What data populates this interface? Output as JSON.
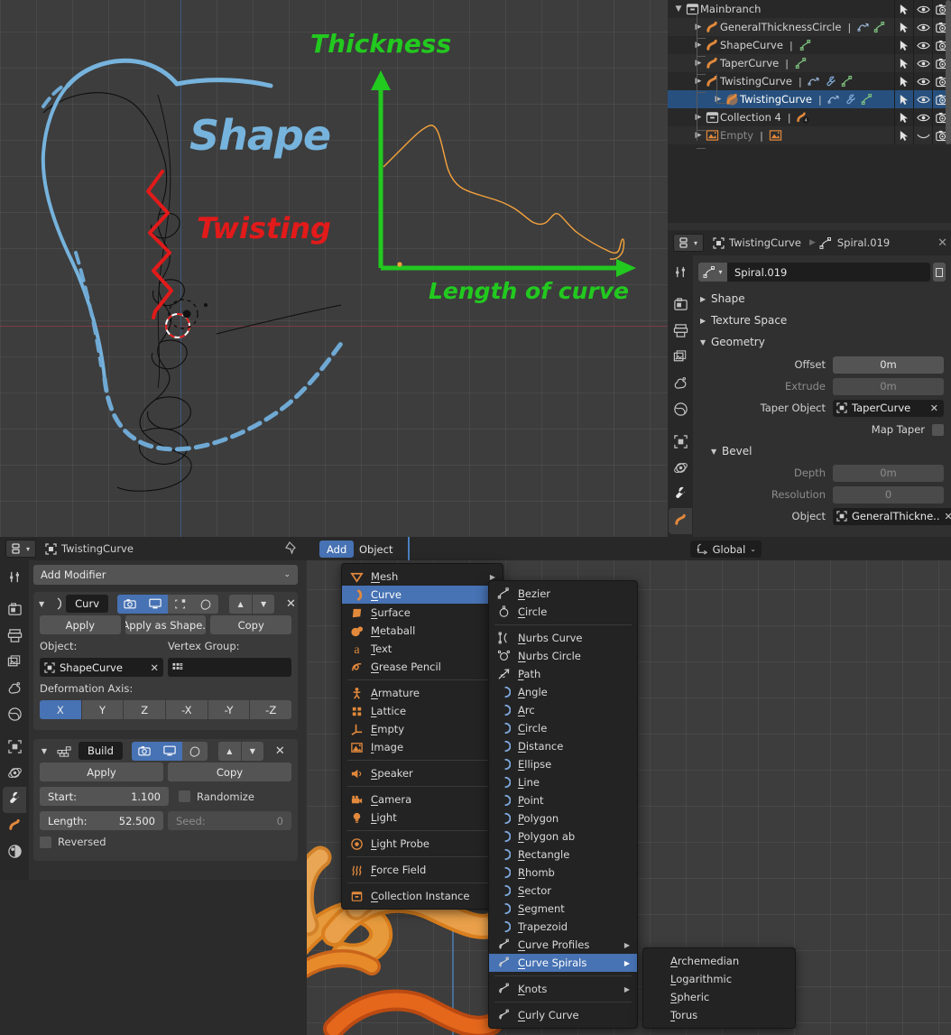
{
  "outliner": {
    "rows": [
      {
        "label": "Mainbranch",
        "icon": "collection-icon",
        "depth": 0,
        "disclosure": "down",
        "selected": false,
        "dimmed": false,
        "badges": []
      },
      {
        "label": "GeneralThicknessCircle",
        "icon": "curve-data-icon",
        "depth": 1,
        "disclosure": "right",
        "selected": false,
        "dimmed": false,
        "badges": [
          "animation-icon",
          "curve-data-icon"
        ]
      },
      {
        "label": "ShapeCurve",
        "icon": "curve-data-icon",
        "depth": 1,
        "disclosure": "right",
        "selected": false,
        "dimmed": false,
        "badges": [
          "curve-data-icon"
        ]
      },
      {
        "label": "TaperCurve",
        "icon": "curve-data-icon",
        "depth": 1,
        "disclosure": "right",
        "selected": false,
        "dimmed": false,
        "badges": [
          "curve-data-icon"
        ]
      },
      {
        "label": "TwistingCurve",
        "icon": "curve-data-icon",
        "depth": 1,
        "disclosure": "right",
        "selected": false,
        "dimmed": false,
        "badges": [
          "animation-icon",
          "wrench-icon",
          "curve-data-icon"
        ]
      },
      {
        "label": "TwistingCurve",
        "icon": "curve-object-icon",
        "depth": 2,
        "disclosure": "right",
        "selected": true,
        "dimmed": false,
        "badges": [
          "animation-icon",
          "wrench-icon",
          "curve-data-icon"
        ]
      },
      {
        "label": "Collection 4",
        "icon": "collection-icon",
        "depth": 1,
        "disclosure": "right",
        "selected": false,
        "dimmed": false,
        "badges": [
          "curve-count-4"
        ]
      },
      {
        "label": "Empty",
        "icon": "image-empty-icon",
        "depth": 1,
        "disclosure": "right",
        "selected": false,
        "dimmed": true,
        "badges": [
          "image-empty-icon"
        ]
      }
    ],
    "row_controls": [
      "cursor-select-icon",
      "eye-visibility-icon",
      "camera-render-icon"
    ]
  },
  "properties": {
    "editor_type": "properties-editor-icon",
    "breadcrumb": [
      {
        "icon": "object-icon",
        "label": "TwistingCurve"
      },
      {
        "icon": "curve-data-icon",
        "label": "Spiral.019"
      }
    ],
    "datablock_name": "Spiral.019",
    "tabs": [
      {
        "name": "tool-icon",
        "active": false
      },
      {
        "name": "render-icon",
        "active": false
      },
      {
        "name": "output-icon",
        "active": false
      },
      {
        "name": "view-layer-icon",
        "active": false
      },
      {
        "name": "scene-icon",
        "active": false
      },
      {
        "name": "world-icon",
        "active": false
      },
      {
        "name": "object-icon",
        "active": false
      },
      {
        "name": "physics-icon",
        "active": false
      },
      {
        "name": "modifier-wrench-icon",
        "active": false
      },
      {
        "name": "curve-data-icon",
        "active": true
      }
    ],
    "panels": [
      {
        "title": "Shape",
        "open": false
      },
      {
        "title": "Texture Space",
        "open": false
      },
      {
        "title": "Geometry",
        "open": true
      }
    ],
    "geometry": {
      "offset_label": "Offset",
      "offset_value": "0m",
      "extrude_label": "Extrude",
      "extrude_value": "0m",
      "taper_label": "Taper Object",
      "taper_value": "TaperCurve",
      "map_taper_label": "Map Taper",
      "map_taper_checked": false
    },
    "bevel": {
      "title": "Bevel",
      "depth_label": "Depth",
      "depth_value": "0m",
      "resolution_label": "Resolution",
      "resolution_value": "0",
      "object_label": "Object",
      "object_value": "GeneralThickne.."
    }
  },
  "modifier_editor": {
    "editor_type": "properties-editor-icon",
    "object_icon": "object-icon",
    "object_name": "TwistingCurve",
    "pin_icon": "pin-icon",
    "add_modifier_label": "Add Modifier",
    "tabs": [
      {
        "name": "tool-icon",
        "active": false
      },
      {
        "name": "render-icon",
        "active": false
      },
      {
        "name": "output-icon",
        "active": false
      },
      {
        "name": "view-layer-icon",
        "active": false
      },
      {
        "name": "scene-icon",
        "active": false
      },
      {
        "name": "world-icon",
        "active": false
      },
      {
        "name": "object-icon",
        "active": false
      },
      {
        "name": "physics-icon",
        "active": false
      },
      {
        "name": "modifier-wrench-icon",
        "active": true
      },
      {
        "name": "curve-data-icon",
        "active": false
      },
      {
        "name": "material-icon",
        "active": false
      }
    ],
    "modifiers": [
      {
        "type": "curve",
        "name": "Curv",
        "icon": "curve-modifier-icon",
        "toggles": [
          {
            "name": "render-toggle",
            "on": true
          },
          {
            "name": "realtime-toggle",
            "on": true
          },
          {
            "name": "edit-mode-toggle",
            "on": false
          },
          {
            "name": "on-cage-toggle",
            "on": false
          }
        ],
        "buttons": [
          "Apply",
          "Apply as Shape..",
          "Copy"
        ],
        "object_label": "Object:",
        "object_value": "ShapeCurve",
        "vertex_group_label": "Vertex Group:",
        "vertex_group_value": "",
        "deformation_axis_label": "Deformation Axis:",
        "axes": [
          "X",
          "Y",
          "Z",
          "-X",
          "-Y",
          "-Z"
        ],
        "axis_selected": "X"
      },
      {
        "type": "build",
        "name": "Build",
        "icon": "build-modifier-icon",
        "toggles": [
          {
            "name": "render-toggle",
            "on": true
          },
          {
            "name": "realtime-toggle",
            "on": true
          },
          {
            "name": "edit-mode-toggle",
            "on": false
          }
        ],
        "buttons": [
          "Apply",
          "Copy"
        ],
        "start_label": "Start:",
        "start_value": "1.100",
        "length_label": "Length:",
        "length_value": "52.500",
        "randomize_label": "Randomize",
        "randomize_checked": false,
        "seed_label": "Seed:",
        "seed_value": "0",
        "reversed_label": "Reversed",
        "reversed_checked": false
      }
    ]
  },
  "bottom_viewport": {
    "header": {
      "menus": [
        {
          "label": "Add",
          "active": true
        },
        {
          "label": "Object",
          "active": false
        }
      ],
      "orientation_label": "Global",
      "orientation_icon": "orientation-gizmo-icon"
    },
    "add_menu": [
      {
        "label": "Mesh",
        "icon": "mesh-icon",
        "submenu": true,
        "sep_after": false,
        "highlight": false
      },
      {
        "label": "Curve",
        "icon": "curve-icon",
        "submenu": true,
        "sep_after": false,
        "highlight": true
      },
      {
        "label": "Surface",
        "icon": "surface-icon",
        "submenu": true,
        "sep_after": false,
        "highlight": false
      },
      {
        "label": "Metaball",
        "icon": "metaball-icon",
        "submenu": true,
        "sep_after": false,
        "highlight": false
      },
      {
        "label": "Text",
        "icon": "text-icon",
        "submenu": false,
        "sep_after": false,
        "highlight": false
      },
      {
        "label": "Grease Pencil",
        "icon": "grease-pencil-icon",
        "submenu": true,
        "sep_after": true,
        "highlight": false
      },
      {
        "label": "Armature",
        "icon": "armature-icon",
        "submenu": true,
        "sep_after": false,
        "highlight": false
      },
      {
        "label": "Lattice",
        "icon": "lattice-icon",
        "submenu": false,
        "sep_after": false,
        "highlight": false
      },
      {
        "label": "Empty",
        "icon": "empty-icon",
        "submenu": true,
        "sep_after": false,
        "highlight": false
      },
      {
        "label": "Image",
        "icon": "image-icon",
        "submenu": true,
        "sep_after": true,
        "highlight": false
      },
      {
        "label": "Speaker",
        "icon": "speaker-icon",
        "submenu": false,
        "sep_after": true,
        "highlight": false
      },
      {
        "label": "Camera",
        "icon": "camera-icon",
        "submenu": false,
        "sep_after": false,
        "highlight": false
      },
      {
        "label": "Light",
        "icon": "light-icon",
        "submenu": true,
        "sep_after": true,
        "highlight": false
      },
      {
        "label": "Light Probe",
        "icon": "light-probe-icon",
        "submenu": true,
        "sep_after": true,
        "highlight": false
      },
      {
        "label": "Force Field",
        "icon": "force-field-icon",
        "submenu": true,
        "sep_after": true,
        "highlight": false
      },
      {
        "label": "Collection Instance",
        "icon": "collection-instance-icon",
        "submenu": true,
        "sep_after": false,
        "highlight": false
      }
    ],
    "curve_menu": [
      {
        "label": "Bezier",
        "icon": "bezier-icon",
        "submenu": false,
        "sep_after": false,
        "highlight": false
      },
      {
        "label": "Circle",
        "icon": "bezier-circle-icon",
        "submenu": false,
        "sep_after": true,
        "highlight": false
      },
      {
        "label": "Nurbs Curve",
        "icon": "nurbs-curve-icon",
        "submenu": false,
        "sep_after": false,
        "highlight": false
      },
      {
        "label": "Nurbs Circle",
        "icon": "nurbs-circle-icon",
        "submenu": false,
        "sep_after": false,
        "highlight": false
      },
      {
        "label": "Path",
        "icon": "path-icon",
        "submenu": false,
        "sep_after": false,
        "highlight": false
      },
      {
        "label": "Angle",
        "icon": "curve-arc-icon",
        "submenu": false,
        "sep_after": false,
        "highlight": false
      },
      {
        "label": "Arc",
        "icon": "curve-arc-icon",
        "submenu": false,
        "sep_after": false,
        "highlight": false
      },
      {
        "label": "Circle",
        "icon": "curve-arc-icon",
        "submenu": false,
        "sep_after": false,
        "highlight": false
      },
      {
        "label": "Distance",
        "icon": "curve-arc-icon",
        "submenu": false,
        "sep_after": false,
        "highlight": false
      },
      {
        "label": "Ellipse",
        "icon": "curve-arc-icon",
        "submenu": false,
        "sep_after": false,
        "highlight": false
      },
      {
        "label": "Line",
        "icon": "curve-arc-icon",
        "submenu": false,
        "sep_after": false,
        "highlight": false
      },
      {
        "label": "Point",
        "icon": "curve-arc-icon",
        "submenu": false,
        "sep_after": false,
        "highlight": false
      },
      {
        "label": "Polygon",
        "icon": "curve-arc-icon",
        "submenu": false,
        "sep_after": false,
        "highlight": false
      },
      {
        "label": "Polygon ab",
        "icon": "curve-arc-icon",
        "submenu": false,
        "sep_after": false,
        "highlight": false
      },
      {
        "label": "Rectangle",
        "icon": "curve-arc-icon",
        "submenu": false,
        "sep_after": false,
        "highlight": false
      },
      {
        "label": "Rhomb",
        "icon": "curve-arc-icon",
        "submenu": false,
        "sep_after": false,
        "highlight": false
      },
      {
        "label": "Sector",
        "icon": "curve-arc-icon",
        "submenu": false,
        "sep_after": false,
        "highlight": false
      },
      {
        "label": "Segment",
        "icon": "curve-arc-icon",
        "submenu": false,
        "sep_after": false,
        "highlight": false
      },
      {
        "label": "Trapezoid",
        "icon": "curve-arc-icon",
        "submenu": false,
        "sep_after": false,
        "highlight": false
      },
      {
        "label": "Curve Profiles",
        "icon": "curve-spiral-icon",
        "submenu": true,
        "sep_after": false,
        "highlight": false
      },
      {
        "label": "Curve Spirals",
        "icon": "curve-spiral-icon",
        "submenu": true,
        "sep_after": true,
        "highlight": true
      },
      {
        "label": "Knots",
        "icon": "curve-spiral-icon",
        "submenu": true,
        "sep_after": true,
        "highlight": false
      },
      {
        "label": "Curly Curve",
        "icon": "curve-spiral-icon",
        "submenu": false,
        "sep_after": false,
        "highlight": false
      }
    ],
    "spirals_menu": [
      {
        "label": "Archemedian"
      },
      {
        "label": "Logarithmic"
      },
      {
        "label": "Spheric"
      },
      {
        "label": "Torus"
      }
    ]
  },
  "annotations": {
    "shape_label": "Shape",
    "twisting_label": "Twisting",
    "thickness_label": "Thickness",
    "length_label": "Length of  curve",
    "colors": {
      "shape": "#76b3dd",
      "twisting": "#e21a1a",
      "thickness": "#22c91f",
      "taper_curve": "#f5a33c",
      "twist_curve": "#111111"
    }
  },
  "chart_data": {
    "type": "line",
    "title": "Thickness",
    "xlabel": "Length of  curve",
    "ylabel": "Thickness",
    "x": [
      0,
      4,
      8,
      12,
      16,
      20,
      24,
      28,
      32,
      36,
      40,
      44,
      48,
      52,
      56,
      60,
      64,
      68,
      72,
      76,
      80,
      84,
      88,
      92,
      96,
      100
    ],
    "values": [
      46,
      55,
      62,
      67,
      72,
      76,
      80,
      83,
      86,
      84,
      72,
      60,
      52,
      48,
      45,
      43,
      41,
      38,
      30,
      26,
      25,
      26,
      30,
      27,
      20,
      12
    ],
    "series_color": "#f5a33c",
    "axis_color": "#22c91f",
    "grid": true,
    "xlim": [
      0,
      100
    ],
    "ylim": [
      0,
      100
    ]
  }
}
